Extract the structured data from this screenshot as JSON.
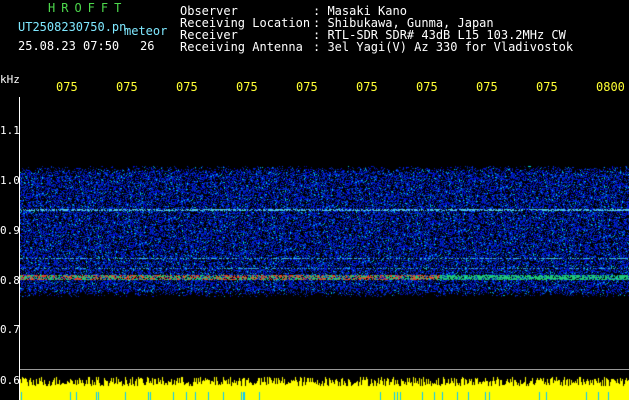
{
  "brand": "HROFFT",
  "file": {
    "name": "UT2508230750.pn",
    "mode": "meteor",
    "datetime": "25.08.23 07:50",
    "count": "26"
  },
  "header": {
    "labels": [
      "Observer",
      "Receiving Location",
      "Receiver",
      "Receiving Antenna"
    ],
    "values": [
      ": Masaki Kano",
      ": Shibukawa, Gunma, Japan",
      ": RTL-SDR SDR# 43dB L15 103.2MHz CW",
      ": 3el Yagi(V) Az 330 for Vladivostok"
    ]
  },
  "axis": {
    "unit": "kHz",
    "x_ticks": [
      "075",
      "075",
      "075",
      "075",
      "075",
      "075",
      "075",
      "075",
      "075",
      "0800"
    ],
    "y_ticks": [
      "1.1",
      "1.0",
      "0.9",
      "0.8",
      "0.7",
      "0.6"
    ]
  },
  "colors": {
    "background": "#000000",
    "noise": "#1a3cff",
    "signal": "#ff3030",
    "level": "#ffff00"
  }
}
